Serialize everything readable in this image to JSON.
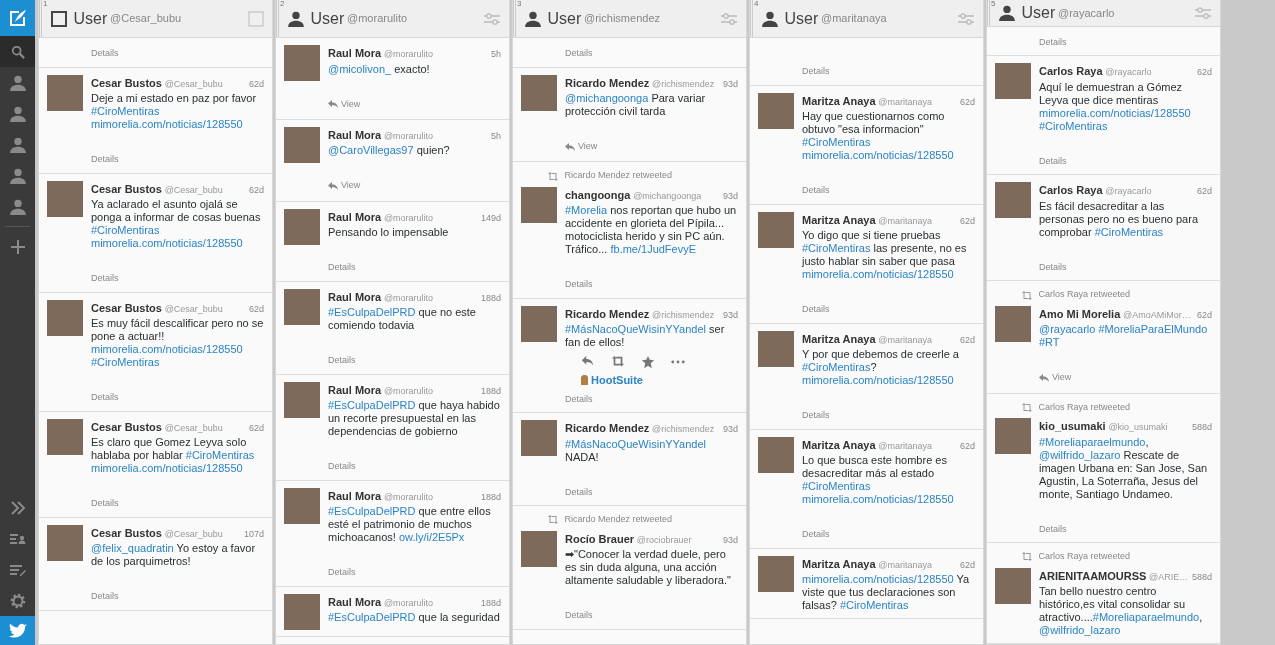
{
  "columns": [
    {
      "number": "1",
      "kind": "selection",
      "title": "User",
      "handle": "@Cesar_bubu",
      "top_footer": {
        "kind": "details",
        "label": "Details"
      },
      "tweets": [
        {
          "name": "Cesar Bustos",
          "handle": "@Cesar_bubu",
          "time": "62d",
          "text": [
            {
              "t": "Deje a mi estado en paz por favor"
            },
            {
              "t": "#CiroMentiras",
              "link": true
            },
            {
              "t": "mimorelia.com/noticias/128550",
              "link": true
            }
          ],
          "footer": {
            "kind": "details",
            "label": "Details"
          }
        },
        {
          "name": "Cesar Bustos",
          "handle": "@Cesar_bubu",
          "time": "62d",
          "text": [
            {
              "t": "Ya aclarado el asunto ojalá se ponga a informar de cosas buenas"
            },
            {
              "t": "#CiroMentiras",
              "link": true
            },
            {
              "t": "mimorelia.com/noticias/128550",
              "link": true
            }
          ],
          "footer": {
            "kind": "details",
            "label": "Details"
          }
        },
        {
          "name": "Cesar Bustos",
          "handle": "@Cesar_bubu",
          "time": "62d",
          "text": [
            {
              "t": "Es muy fácil descalificar pero no se pone a actuar!!"
            },
            {
              "t": "mimorelia.com/noticias/128550",
              "link": true
            },
            {
              "t": "#CiroMentiras",
              "link": true
            }
          ],
          "footer": {
            "kind": "details",
            "label": "Details"
          }
        },
        {
          "name": "Cesar Bustos",
          "handle": "@Cesar_bubu",
          "time": "62d",
          "text": [
            {
              "t": "Es claro que Gomez Leyva solo hablaba por hablar"
            },
            {
              "t": "#CiroMentiras",
              "link": true
            },
            {
              "t": "mimorelia.com/noticias/128550",
              "link": true
            }
          ],
          "footer": {
            "kind": "details",
            "label": "Details"
          }
        },
        {
          "name": "Cesar Bustos",
          "handle": "@Cesar_bubu",
          "time": "107d",
          "text": [
            {
              "t": "@felix_quadratin",
              "link": true
            },
            {
              "t": "Yo estoy a favor de los parquimetros!"
            }
          ],
          "footer": {
            "kind": "details",
            "label": "Details"
          }
        }
      ]
    },
    {
      "number": "2",
      "kind": "user",
      "title": "User",
      "handle": "@morarulito",
      "tweets": [
        {
          "name": "Raul Mora",
          "handle": "@morarulito",
          "time": "5h",
          "text": [
            {
              "t": "@micolivon_",
              "link": true
            },
            {
              "t": "exacto!"
            }
          ],
          "footer": {
            "kind": "view",
            "label": "View"
          }
        },
        {
          "name": "Raul Mora",
          "handle": "@morarulito",
          "time": "5h",
          "text": [
            {
              "t": "@CaroVillegas97",
              "link": true
            },
            {
              "t": "quien?"
            }
          ],
          "footer": {
            "kind": "view",
            "label": "View"
          }
        },
        {
          "name": "Raul Mora",
          "handle": "@morarulito",
          "time": "149d",
          "text": [
            {
              "t": "Pensando lo impensable"
            }
          ],
          "footer": {
            "kind": "details",
            "label": "Details"
          }
        },
        {
          "name": "Raul Mora",
          "handle": "@morarulito",
          "time": "188d",
          "text": [
            {
              "t": "#EsCulpaDelPRD",
              "link": true
            },
            {
              "t": "que no este comiendo todavia"
            }
          ],
          "footer": {
            "kind": "details",
            "label": "Details"
          }
        },
        {
          "name": "Raul Mora",
          "handle": "@morarulito",
          "time": "188d",
          "text": [
            {
              "t": "#EsCulpaDelPRD",
              "link": true
            },
            {
              "t": "que haya habido un recorte presupuestal en las dependencias de gobierno"
            }
          ],
          "footer": {
            "kind": "details",
            "label": "Details"
          }
        },
        {
          "name": "Raul Mora",
          "handle": "@morarulito",
          "time": "188d",
          "text": [
            {
              "t": "#EsCulpaDelPRD",
              "link": true
            },
            {
              "t": "que entre ellos esté el patrimonio de muchos michoacanos!"
            },
            {
              "t": "ow.ly/i/2E5Px",
              "link": true
            }
          ],
          "footer": {
            "kind": "details",
            "label": "Details"
          }
        },
        {
          "name": "Raul Mora",
          "handle": "@morarulito",
          "time": "188d",
          "text": [
            {
              "t": "#EsCulpaDelPRD",
              "link": true
            },
            {
              "t": "que la seguridad"
            }
          ]
        }
      ]
    },
    {
      "number": "3",
      "kind": "user",
      "title": "User",
      "handle": "@richismendez",
      "top_footer": {
        "kind": "details",
        "label": "Details"
      },
      "tweets": [
        {
          "name": "Ricardo Mendez",
          "handle": "@richismendez",
          "time": "93d",
          "text": [
            {
              "t": "@michangoonga",
              "link": true
            },
            {
              "t": "Para variar protección civil tarda"
            }
          ],
          "footer": {
            "kind": "view",
            "label": "View"
          }
        },
        {
          "retweeted_by": "Ricardo Mendez retweeted",
          "name": "changoonga",
          "handle": "@michangoonga",
          "time": "93d",
          "text": [
            {
              "t": "#Morelia",
              "link": true
            },
            {
              "t": "nos reportan que hubo un accidente en glorieta del Pípila... motociclista herido y sin PC aún. Tráfico..."
            },
            {
              "t": "fb.me/1JudFevyE",
              "link": true
            }
          ],
          "footer": {
            "kind": "details",
            "label": "Details"
          }
        },
        {
          "name": "Ricardo Mendez",
          "handle": "@richismendez",
          "time": "93d",
          "text": [
            {
              "t": "#MásNacoQueWisinYYandel",
              "link": true
            },
            {
              "t": "ser fan de ellos!"
            }
          ],
          "actions": true,
          "source": "HootSuite",
          "footer": {
            "kind": "details",
            "label": "Details"
          }
        },
        {
          "name": "Ricardo Mendez",
          "handle": "@richismendez",
          "time": "93d",
          "text": [
            {
              "t": "#MásNacoQueWisinYYandel",
              "link": true
            },
            {
              "t": "NADA!"
            }
          ],
          "footer": {
            "kind": "details",
            "label": "Details"
          }
        },
        {
          "retweeted_by": "Ricardo Mendez retweeted",
          "name": "Rocío Brauer",
          "handle": "@rociobrauer",
          "time": "93d",
          "text": [
            {
              "t": "➡\"Conocer la verdad duele, pero es sin duda alguna, una acción altamente saludable y liberadora.\""
            }
          ],
          "footer": {
            "kind": "details",
            "label": "Details"
          }
        }
      ]
    },
    {
      "number": "4",
      "kind": "user",
      "title": "User",
      "handle": "@maritanaya",
      "top_footer": {
        "kind": "details",
        "label": "Details"
      },
      "tweets": [
        {
          "name": "Maritza Anaya",
          "handle": "@maritanaya",
          "time": "62d",
          "text": [
            {
              "t": "Hay que cuestionarnos como obtuvo \"esa informacion\""
            },
            {
              "t": "#CiroMentiras",
              "link": true
            },
            {
              "t": "mimorelia.com/noticias/128550",
              "link": true
            }
          ],
          "footer": {
            "kind": "details",
            "label": "Details"
          }
        },
        {
          "name": "Maritza Anaya",
          "handle": "@maritanaya",
          "time": "62d",
          "text": [
            {
              "t": "Yo digo que si tiene pruebas"
            },
            {
              "t": "#CiroMentiras",
              "link": true
            },
            {
              "t": "las presente, no es justo hablar sin saber que pasa"
            },
            {
              "t": "mimorelia.com/noticias/128550",
              "link": true
            }
          ],
          "footer": {
            "kind": "details",
            "label": "Details"
          }
        },
        {
          "name": "Maritza Anaya",
          "handle": "@maritanaya",
          "time": "62d",
          "text": [
            {
              "t": "Y por que debemos de creerle a"
            },
            {
              "t": "#CiroMentiras",
              "link": true
            },
            {
              "t": "?",
              "attached": true
            },
            {
              "t": "mimorelia.com/noticias/128550",
              "link": true
            }
          ],
          "footer": {
            "kind": "details",
            "label": "Details"
          }
        },
        {
          "name": "Maritza Anaya",
          "handle": "@maritanaya",
          "time": "62d",
          "text": [
            {
              "t": "Lo que busca este hombre es desacreditar más al estado"
            },
            {
              "t": "#CiroMentiras",
              "link": true
            },
            {
              "t": "mimorelia.com/noticias/128550",
              "link": true
            }
          ],
          "footer": {
            "kind": "details",
            "label": "Details"
          }
        },
        {
          "name": "Maritza Anaya",
          "handle": "@maritanaya",
          "time": "62d",
          "text": [
            {
              "t": "mimorelia.com/noticias/128550",
              "link": true
            },
            {
              "t": "Ya viste que tus declaraciones son falsas?"
            },
            {
              "t": "#CiroMentiras",
              "link": true
            }
          ]
        }
      ]
    },
    {
      "number": "5",
      "kind": "user",
      "title": "User",
      "handle": "@rayacarlo",
      "top_footer": {
        "kind": "details",
        "label": "Details"
      },
      "tweets": [
        {
          "name": "Carlos Raya",
          "handle": "@rayacarlo",
          "time": "62d",
          "text": [
            {
              "t": "Aquí le demuestran a Gómez Leyva que dice mentiras"
            },
            {
              "t": "mimorelia.com/noticias/128550",
              "link": true
            },
            {
              "t": "#CiroMentiras",
              "link": true
            }
          ],
          "footer": {
            "kind": "details",
            "label": "Details"
          }
        },
        {
          "name": "Carlos Raya",
          "handle": "@rayacarlo",
          "time": "62d",
          "text": [
            {
              "t": "Es fácil desacreditar a las personas pero no es bueno para comprobar"
            },
            {
              "t": "#CiroMentiras",
              "link": true
            }
          ],
          "footer": {
            "kind": "details",
            "label": "Details"
          }
        },
        {
          "retweeted_by": "Carlos Raya retweeted",
          "name": "Amo Mi Morelia",
          "handle": "@AmoAMiMor…",
          "time": "62d",
          "text": [
            {
              "t": "@rayacarlo",
              "link": true
            },
            {
              "t": "#MoreliaParaElMundo",
              "link": true
            },
            {
              "t": "#RT",
              "link": true
            }
          ],
          "footer": {
            "kind": "view",
            "label": "View"
          }
        },
        {
          "retweeted_by": "Carlos Raya retweeted",
          "name": "kio_usumaki",
          "handle": "@kio_usumaki",
          "time": "588d",
          "text": [
            {
              "t": "#Moreliaparaelmundo",
              "link": true
            },
            {
              "t": ",",
              "attached": true
            },
            {
              "t": "@wilfrido_lazaro",
              "link": true
            },
            {
              "t": "Rescate de imagen Urbana en: San Jose, San Agustin, La Soterraña, Jesus del monte, Santiago Undameo."
            }
          ],
          "footer": {
            "kind": "details",
            "label": "Details"
          }
        },
        {
          "retweeted_by": "Carlos Raya retweeted",
          "name": "ARIENITAAMOURSS",
          "handle": "@ARIE…",
          "time": "588d",
          "text": [
            {
              "t": "Tan bello  nuestro centro histórico,es vital consolidar su atractivo...."
            },
            {
              "t": "#Moreliaparaelmundo",
              "link": true,
              "attached": true
            },
            {
              "t": ",",
              "attached": true
            },
            {
              "t": "@wilfrido_lazaro",
              "link": true
            }
          ]
        }
      ]
    }
  ]
}
